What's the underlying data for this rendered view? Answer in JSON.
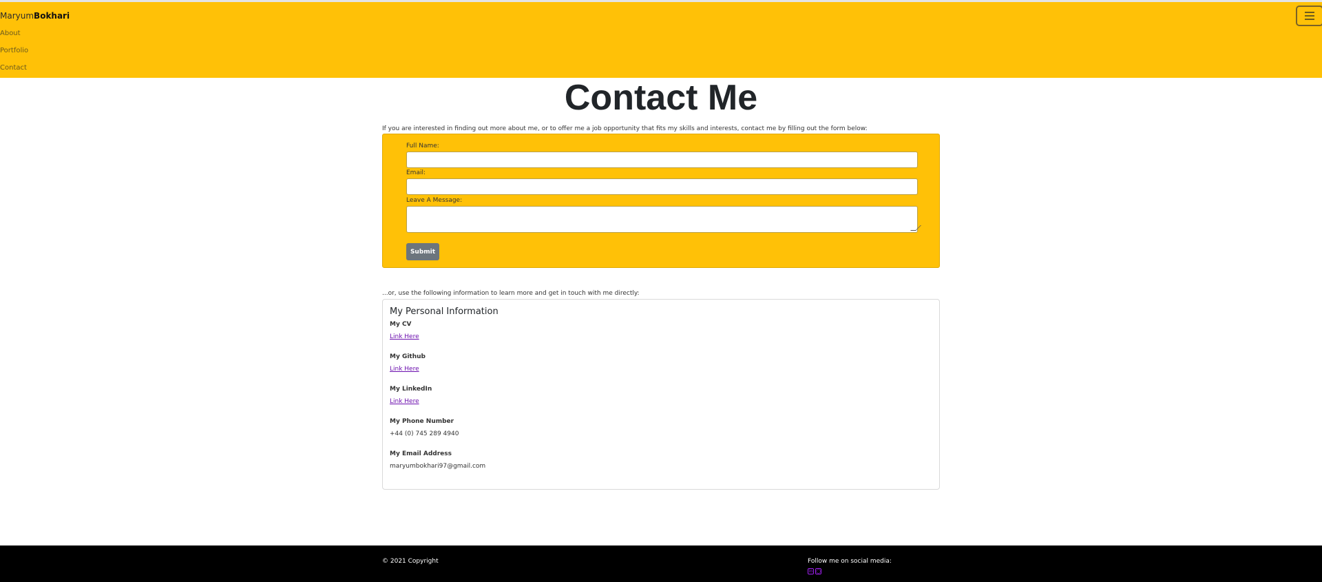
{
  "nav": {
    "brand_first": "Maryum",
    "brand_last": "Bokhari",
    "links": [
      "About",
      "Portfolio",
      "Contact"
    ],
    "toggler_icon": "hamburger-icon"
  },
  "page": {
    "title": "Contact Me",
    "intro": "If you are interested in finding out more about me, or to offer me a job opportunity that fits my skills and interests, contact me by filling out the form below:"
  },
  "form": {
    "name_label": "Full Name:",
    "email_label": "Email:",
    "message_label": "Leave A Message:",
    "name_value": "",
    "email_value": "",
    "message_value": "",
    "submit_label": "Submit"
  },
  "info": {
    "or_text": "...or, use the following information to learn more and get in touch with me directly:",
    "card_title": "My Personal Information",
    "cv_label": "My CV",
    "cv_link": "Link Here",
    "github_label": "My Github",
    "github_link": "Link Here",
    "linkedin_label": "My LinkedIn",
    "linkedin_link": "Link Here",
    "phone_label": "My Phone Number",
    "phone_value": "+44 (0) 745 289 4940",
    "email_label": "My Email Address",
    "email_value": "maryumbokhari97@gmail.com"
  },
  "footer": {
    "copyright": "© 2021 Copyright",
    "follow": "Follow me on social media:",
    "icons": [
      "linkedin-icon",
      "instagram-icon"
    ]
  },
  "colors": {
    "accent": "#ffc107",
    "button": "#6c757d",
    "link": "#6a0dad",
    "footer": "#000000"
  }
}
